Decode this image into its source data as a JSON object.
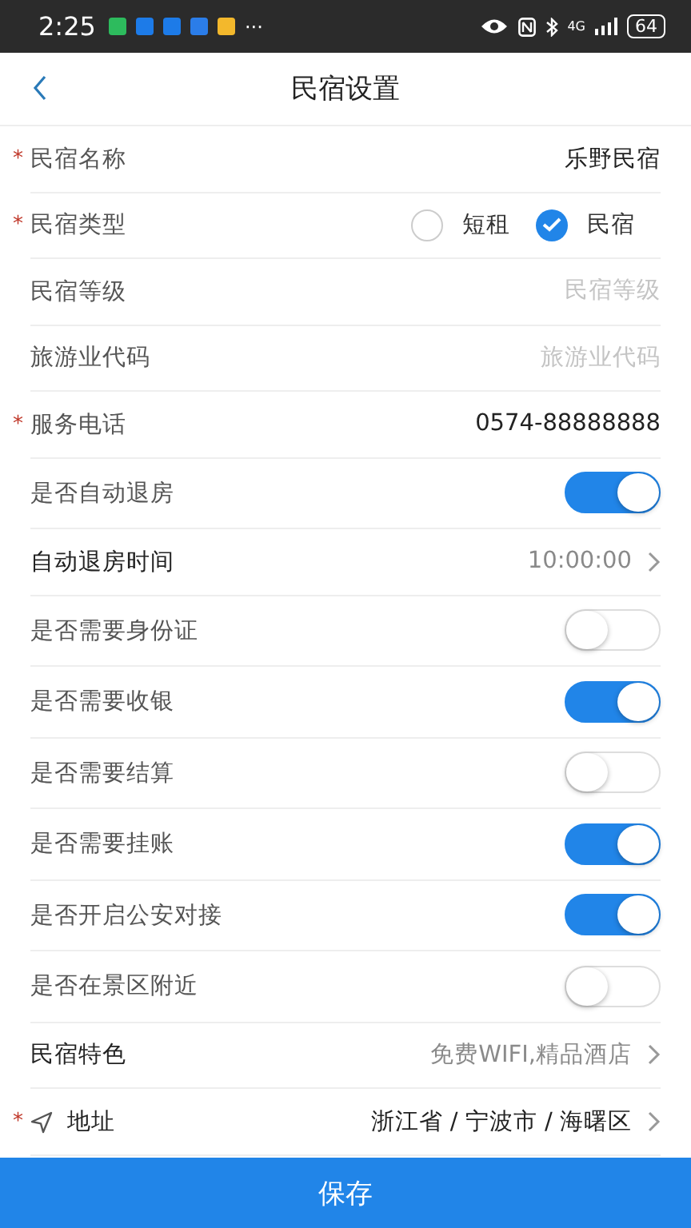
{
  "status_bar": {
    "time": "2:25",
    "more": "···",
    "network": "4G",
    "battery": "64"
  },
  "header": {
    "title": "民宿设置"
  },
  "rows": [
    {
      "kind": "text",
      "label": "民宿名称",
      "required_mark": "*",
      "value": "乐野民宿"
    },
    {
      "kind": "radio",
      "label": "民宿类型",
      "required_mark": "*",
      "options": [
        {
          "label": "短租",
          "selected": false
        },
        {
          "label": "民宿",
          "selected": true
        }
      ]
    },
    {
      "kind": "field",
      "label": "民宿等级",
      "placeholder": "民宿等级"
    },
    {
      "kind": "field",
      "label": "旅游业代码",
      "placeholder": "旅游业代码"
    },
    {
      "kind": "text",
      "label": "服务电话",
      "required_mark": "*",
      "value": "0574-88888888"
    },
    {
      "kind": "switch",
      "label": "是否自动退房",
      "on": true
    },
    {
      "kind": "link",
      "label": "自动退房时间",
      "value": "10:00:00"
    },
    {
      "kind": "switch",
      "label": "是否需要身份证",
      "on": false
    },
    {
      "kind": "switch",
      "label": "是否需要收银",
      "on": true
    },
    {
      "kind": "switch",
      "label": "是否需要结算",
      "on": false
    },
    {
      "kind": "switch",
      "label": "是否需要挂账",
      "on": true
    },
    {
      "kind": "switch",
      "label": "是否开启公安对接",
      "on": true
    },
    {
      "kind": "switch",
      "label": "是否在景区附近",
      "on": false
    },
    {
      "kind": "link",
      "label": "民宿特色",
      "value": "免费WIFI,精品酒店"
    },
    {
      "kind": "address",
      "label": "地址",
      "required_mark": "*",
      "value": "浙江省 / 宁波市 / 海曙区"
    }
  ],
  "save_button": "保存"
}
